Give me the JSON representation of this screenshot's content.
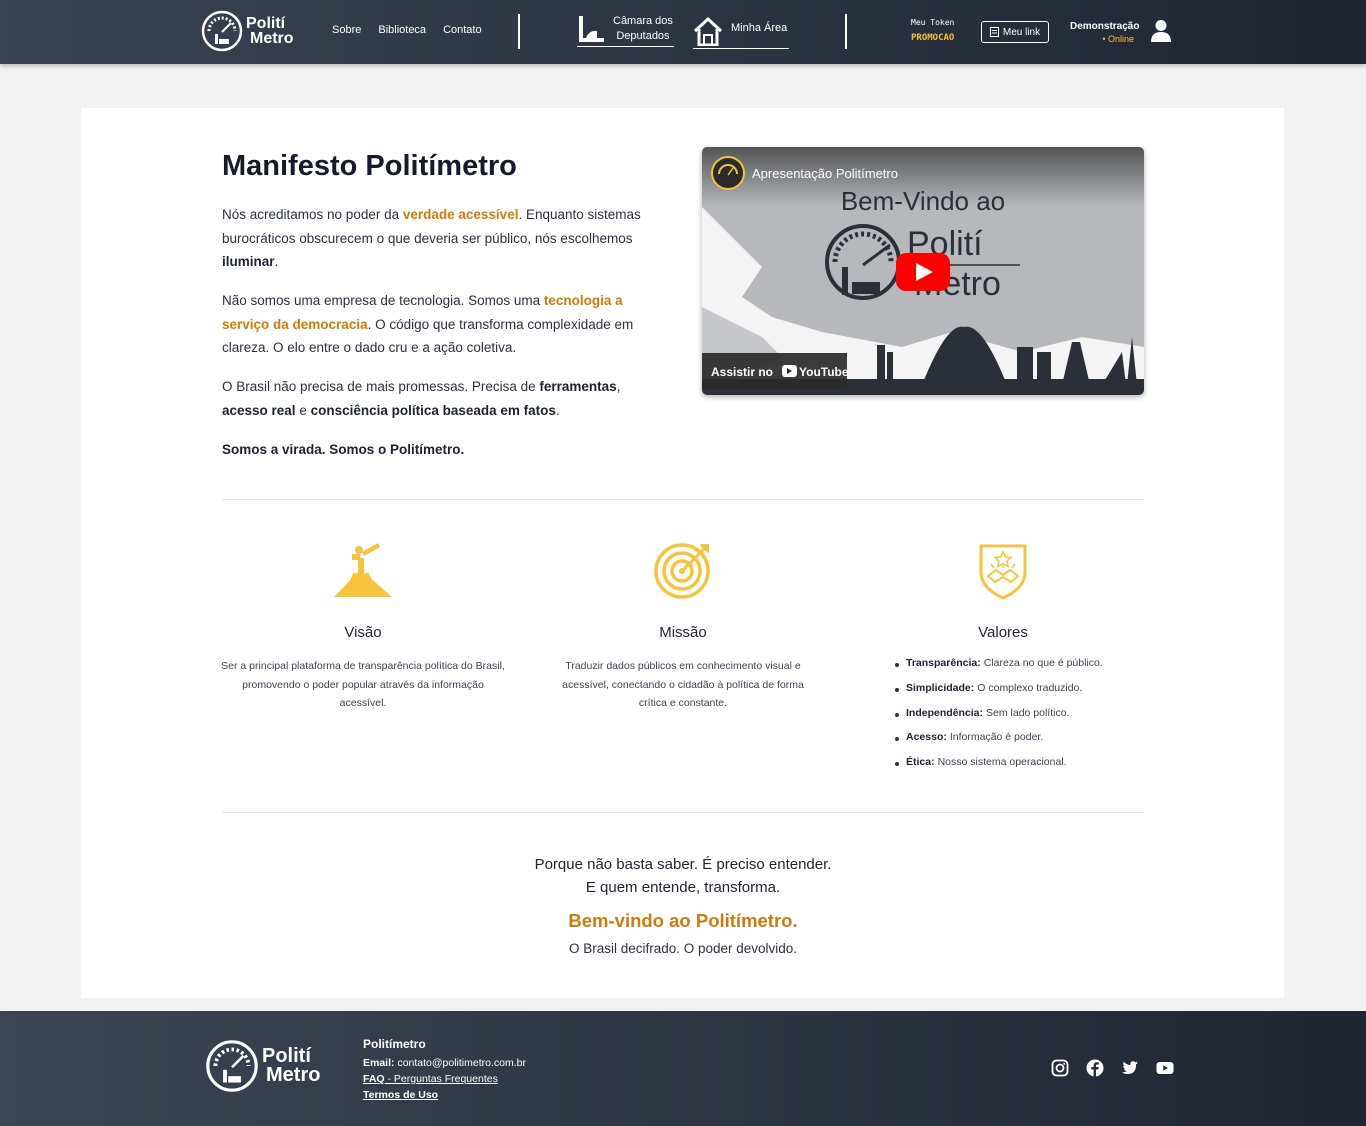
{
  "brand": {
    "line1": "Polití",
    "line2": "Metro"
  },
  "nav": {
    "links": [
      "Sobre",
      "Biblioteca",
      "Contato"
    ],
    "camara_line1": "Câmara dos",
    "camara_line2": "Deputados",
    "minha_area": "Minha Área"
  },
  "token": {
    "label": "Meu Token",
    "value": "PROMOCAO"
  },
  "meu_link": "Meu link",
  "user": {
    "name": "Demonstração",
    "status": "• Online"
  },
  "manifesto": {
    "title": "Manifesto Politímetro",
    "p1": {
      "a": "Nós acreditamos no poder da ",
      "hl": "verdade acessível",
      "b": ". Enquanto sistemas burocráticos obscurecem o que deveria ser público, nós escolhemos ",
      "bold": "iluminar",
      "c": "."
    },
    "p2": {
      "a": "Não somos uma empresa de tecnologia. Somos uma ",
      "hl": "tecnologia a serviço da democracia",
      "b": ". O código que transforma complexidade em clareza. O elo entre o dado cru e a ação coletiva."
    },
    "p3": {
      "a": "O Brasil não precisa de mais promessas. Precisa de ",
      "b1": "ferramentas",
      "sep1": ", ",
      "b2": "acesso real",
      "sep2": " e ",
      "b3": "consciência política baseada em fatos",
      "end": "."
    },
    "p4": "Somos a virada. Somos o Politímetro."
  },
  "video": {
    "title": "Apresentação Politímetro",
    "headline": "Bem-Vindo ao",
    "logo_line1": "Polití",
    "logo_line2": "Metro",
    "watch_label": "Assistir no",
    "youtube_label": "YouTube"
  },
  "pillars": {
    "visao": {
      "title": "Visão",
      "text": "Ser a principal plataforma de transparência política do Brasil, promovendo o poder popular através da informação acessível."
    },
    "missao": {
      "title": "Missão",
      "text": "Traduzir dados públicos em conhecimento visual e acessível, conectando o cidadão à política de forma crítica e constante."
    },
    "valores": {
      "title": "Valores",
      "items": [
        {
          "term": "Transparência:",
          "desc": "Clareza no que é público."
        },
        {
          "term": "Simplicidade:",
          "desc": "O complexo traduzido."
        },
        {
          "term": "Independência:",
          "desc": "Sem lado político."
        },
        {
          "term": "Acesso:",
          "desc": "Informação é poder."
        },
        {
          "term": "Ética:",
          "desc": "Nosso sistema operacional."
        }
      ]
    }
  },
  "closing": {
    "line1": "Porque não basta saber. É preciso entender.",
    "line2": "E quem entende, transforma.",
    "welcome": "Bem-vindo ao Politímetro.",
    "tagline": "O Brasil decifrado. O poder devolvido."
  },
  "footer": {
    "title": "Politímetro",
    "email_label": "Email:",
    "email": "contato@politimetro.com.br",
    "faq_label": "FAQ",
    "faq_text": " - Perguntas Frequentes",
    "terms": "Termos de Uso",
    "socials": [
      "instagram-icon",
      "facebook-icon",
      "twitter-icon",
      "youtube-icon"
    ]
  },
  "colors": {
    "accent": "#d27a05",
    "gold": "#f6c33b",
    "header_bg": "#2b3342"
  }
}
